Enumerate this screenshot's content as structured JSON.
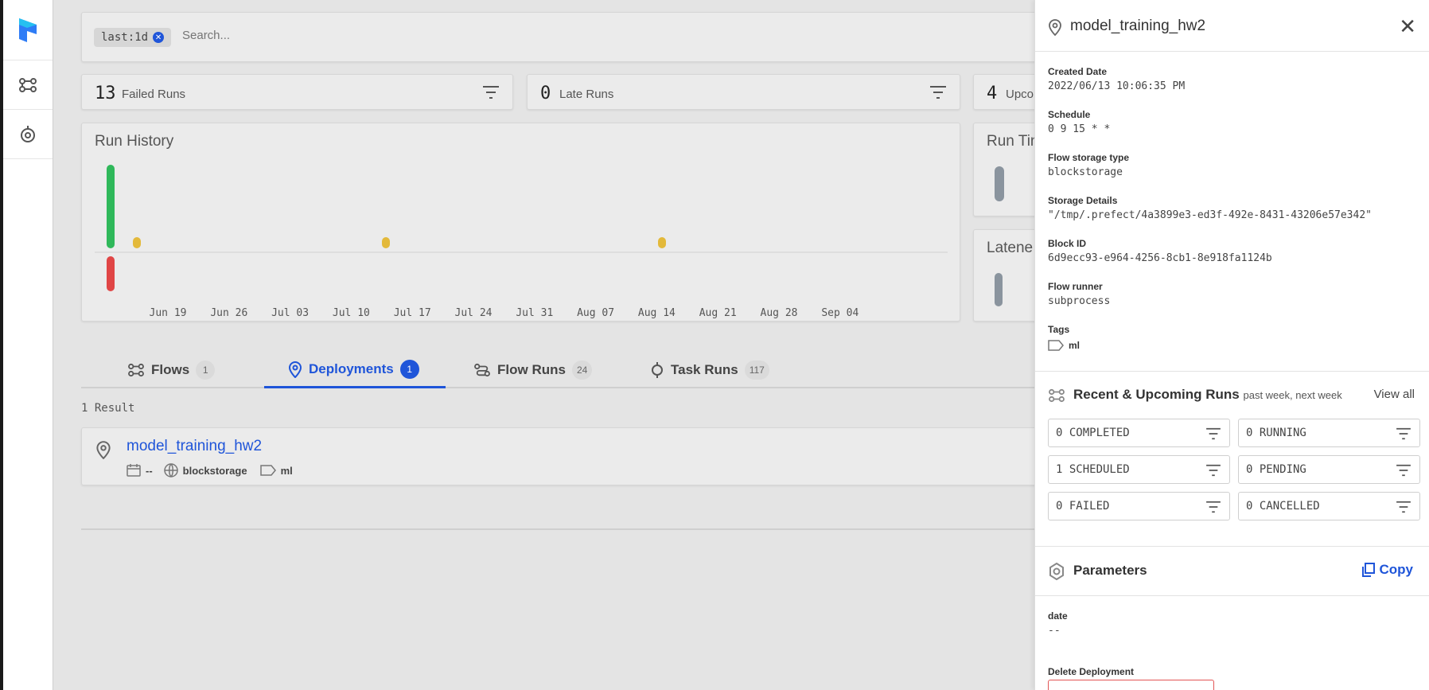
{
  "sidebar": {
    "items": [
      {
        "icon": "prefect-logo-icon"
      },
      {
        "icon": "flows-icon"
      },
      {
        "icon": "work-queue-icon"
      }
    ]
  },
  "search": {
    "chip": "last:1d",
    "placeholder": "Search..."
  },
  "stats": [
    {
      "count": "13",
      "label": "Failed Runs"
    },
    {
      "count": "0",
      "label": "Late Runs"
    },
    {
      "count": "4",
      "label": "Upco"
    }
  ],
  "run_history": {
    "title": "Run History",
    "x_labels": [
      "Jun 19",
      "Jun 26",
      "Jul 03",
      "Jul 10",
      "Jul 17",
      "Jul 24",
      "Jul 31",
      "Aug 07",
      "Aug 14",
      "Aug 21",
      "Aug 28",
      "Sep 04"
    ]
  },
  "side_cards": {
    "run_times": "Run Tin",
    "lateness": "Latene"
  },
  "tabs": [
    {
      "label": "Flows",
      "count": "1"
    },
    {
      "label": "Deployments",
      "count": "1"
    },
    {
      "label": "Flow Runs",
      "count": "24"
    },
    {
      "label": "Task Runs",
      "count": "117"
    }
  ],
  "result_count": "1 Result",
  "deployment": {
    "name": "model_training_hw2",
    "schedule": "--",
    "storage": "blockstorage",
    "tag": "ml"
  },
  "panel": {
    "title": "model_training_hw2",
    "fields": [
      {
        "label": "Created Date",
        "value": "2022/06/13 10:06:35 PM"
      },
      {
        "label": "Schedule",
        "value": "0 9 15 * *"
      },
      {
        "label": "Flow storage type",
        "value": "blockstorage"
      },
      {
        "label": "Storage Details",
        "value": "\"/tmp/.prefect/4a3899e3-ed3f-492e-8431-43206e57e342\""
      },
      {
        "label": "Block ID",
        "value": "6d9ecc93-e964-4256-8cb1-8e918fa1124b"
      },
      {
        "label": "Flow runner",
        "value": "subprocess"
      }
    ],
    "tags_label": "Tags",
    "tag": "ml",
    "recent_title": "Recent & Upcoming Runs",
    "recent_sub": "past week, next week",
    "view_all": "View all",
    "states": [
      {
        "text": "0 COMPLETED"
      },
      {
        "text": "0 RUNNING"
      },
      {
        "text": "1 SCHEDULED"
      },
      {
        "text": "0 PENDING"
      },
      {
        "text": "0 FAILED"
      },
      {
        "text": "0 CANCELLED"
      }
    ],
    "params_title": "Parameters",
    "copy_label": "Copy",
    "param_name": "date",
    "param_value": "--",
    "delete_label": "Delete Deployment"
  },
  "colors": {
    "accent": "#1f55d9",
    "completed": "#2fb85a",
    "failed": "#e04545",
    "scheduled": "#e3b93a",
    "grey_bar": "#8a949e"
  }
}
